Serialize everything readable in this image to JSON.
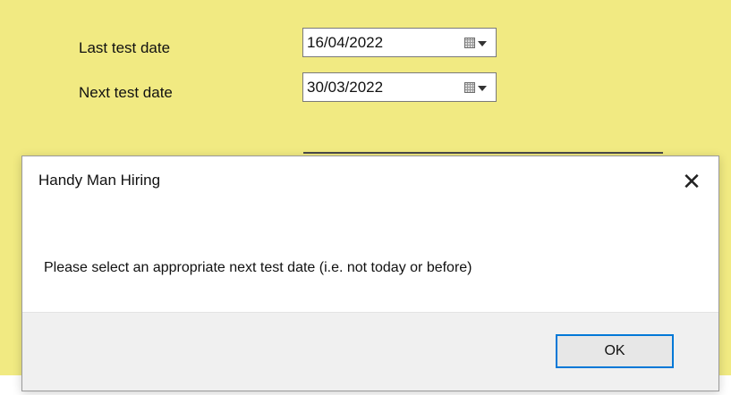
{
  "form": {
    "fields": [
      {
        "label": "Last test date",
        "value": "16/04/2022",
        "dropdown_icon": "calendar-dropdown-icon"
      },
      {
        "label": "Next test date",
        "value": "30/03/2022",
        "dropdown_icon": "calendar-dropdown-icon"
      }
    ],
    "background_color": "#f1ea82"
  },
  "dialog": {
    "title": "Handy Man Hiring",
    "message": "Please select an appropriate next test date (i.e. not today or before)",
    "close_glyph": "✕",
    "ok_label": "OK",
    "accent_color": "#0078d7"
  }
}
